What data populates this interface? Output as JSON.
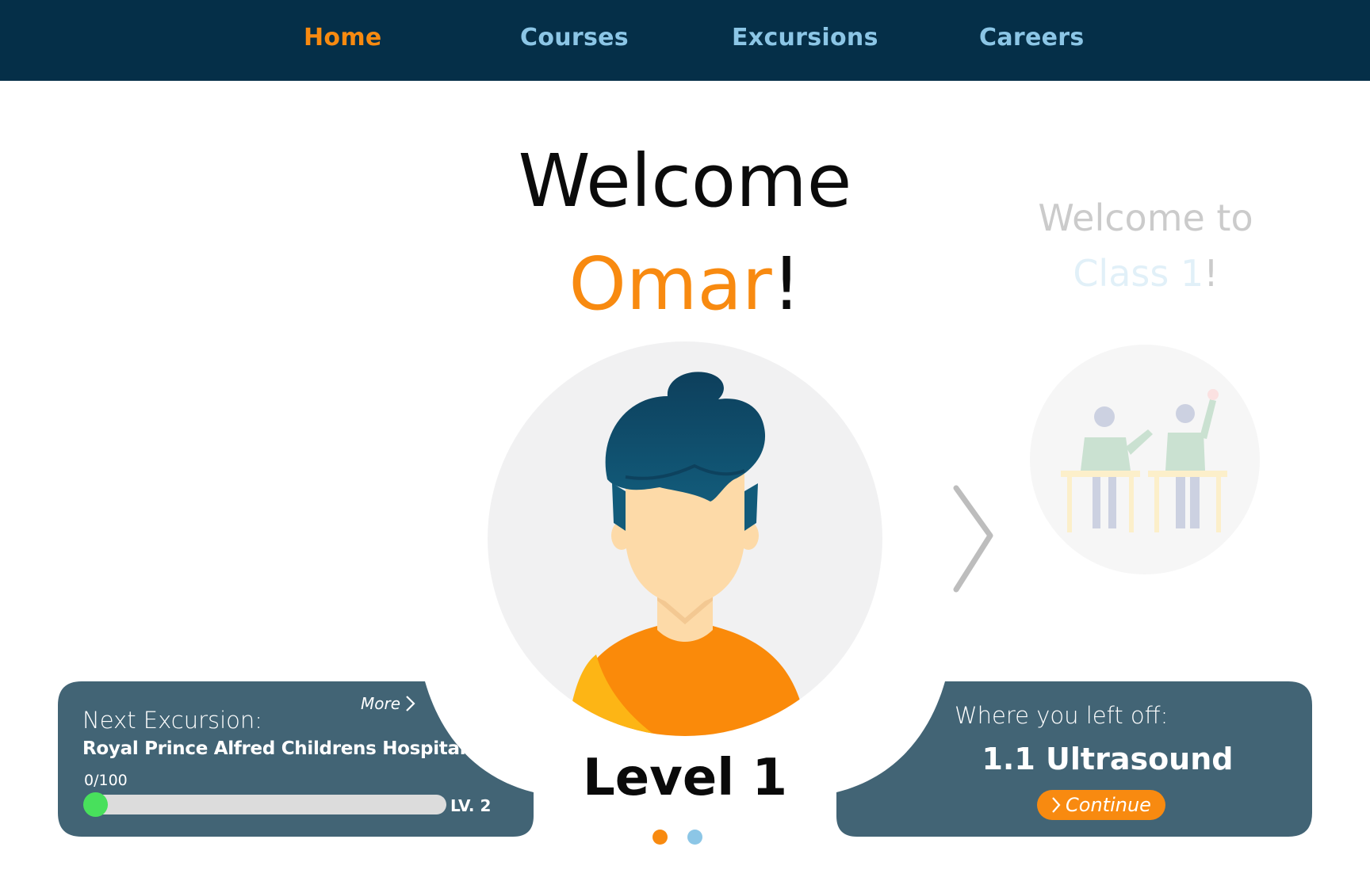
{
  "nav": {
    "items": [
      {
        "label": "Home",
        "active": true
      },
      {
        "label": "Courses",
        "active": false
      },
      {
        "label": "Excursions",
        "active": false
      },
      {
        "label": "Careers",
        "active": false
      }
    ]
  },
  "welcome": {
    "line1": "Welcome",
    "name": "Omar",
    "exclaim": "!"
  },
  "level": "Level 1",
  "carousel": {
    "next_slide": {
      "line1": "Welcome to",
      "class_name": "Class 1",
      "exclaim": "!"
    },
    "dots": [
      {
        "color": "#f88a10",
        "active": true
      },
      {
        "color": "#8cc6e6",
        "active": false
      }
    ]
  },
  "next_excursion": {
    "heading": "Next Excursion:",
    "name": "Royal Prince Alfred Childrens Hospital",
    "more_label": "More",
    "progress_text": "0/100",
    "progress_fraction": 0,
    "next_level": "LV. 2"
  },
  "left_off": {
    "heading": "Where you left off:",
    "lesson": "1.1 Ultrasound",
    "continue_label": "Continue"
  },
  "colors": {
    "nav_bg": "#052f48",
    "accent": "#f88a10",
    "light_blue": "#8cc6e6",
    "panel_bg": "#426475",
    "progress_green": "#48e05c"
  }
}
